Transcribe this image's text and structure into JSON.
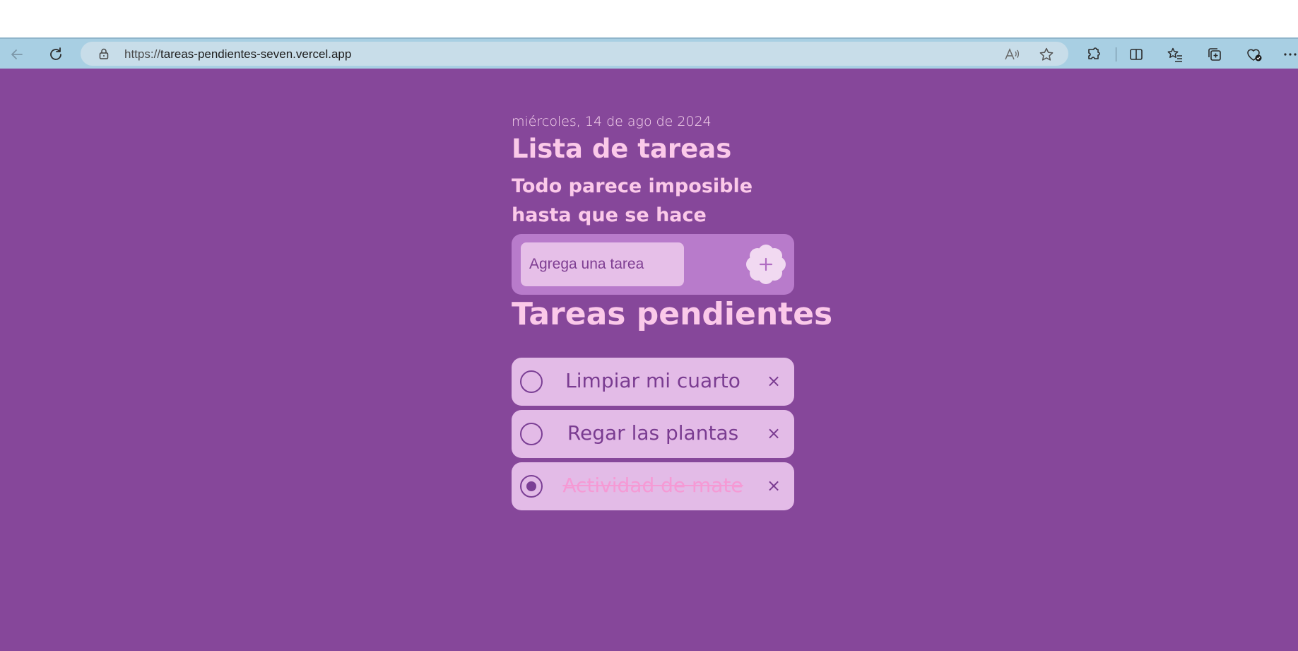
{
  "browser": {
    "url_protocol": "https://",
    "url_host": "tareas-pendientes-seven.vercel.app"
  },
  "app": {
    "date": "miércoles, 14 de ago de 2024",
    "title": "Lista de tareas",
    "subtitle": "Todo parece imposible hasta que se hace",
    "input_placeholder": "Agrega una tarea",
    "add_button_icon": "plus-icon",
    "section_title": "Tareas pendientes",
    "tasks": [
      {
        "text": "Limpiar mi cuarto",
        "completed": false
      },
      {
        "text": "Regar las plantas",
        "completed": false
      },
      {
        "text": "Actividad de mate",
        "completed": true
      }
    ],
    "delete_glyph": "×"
  },
  "colors": {
    "page_background": "#86479a",
    "heading": "#fbc9e9",
    "panel": "#b87bcb",
    "item_background": "#e3bbe7",
    "item_text": "#7a3c91",
    "completed_text": "#f59ad5",
    "browser_bar": "#a8cfe3"
  }
}
